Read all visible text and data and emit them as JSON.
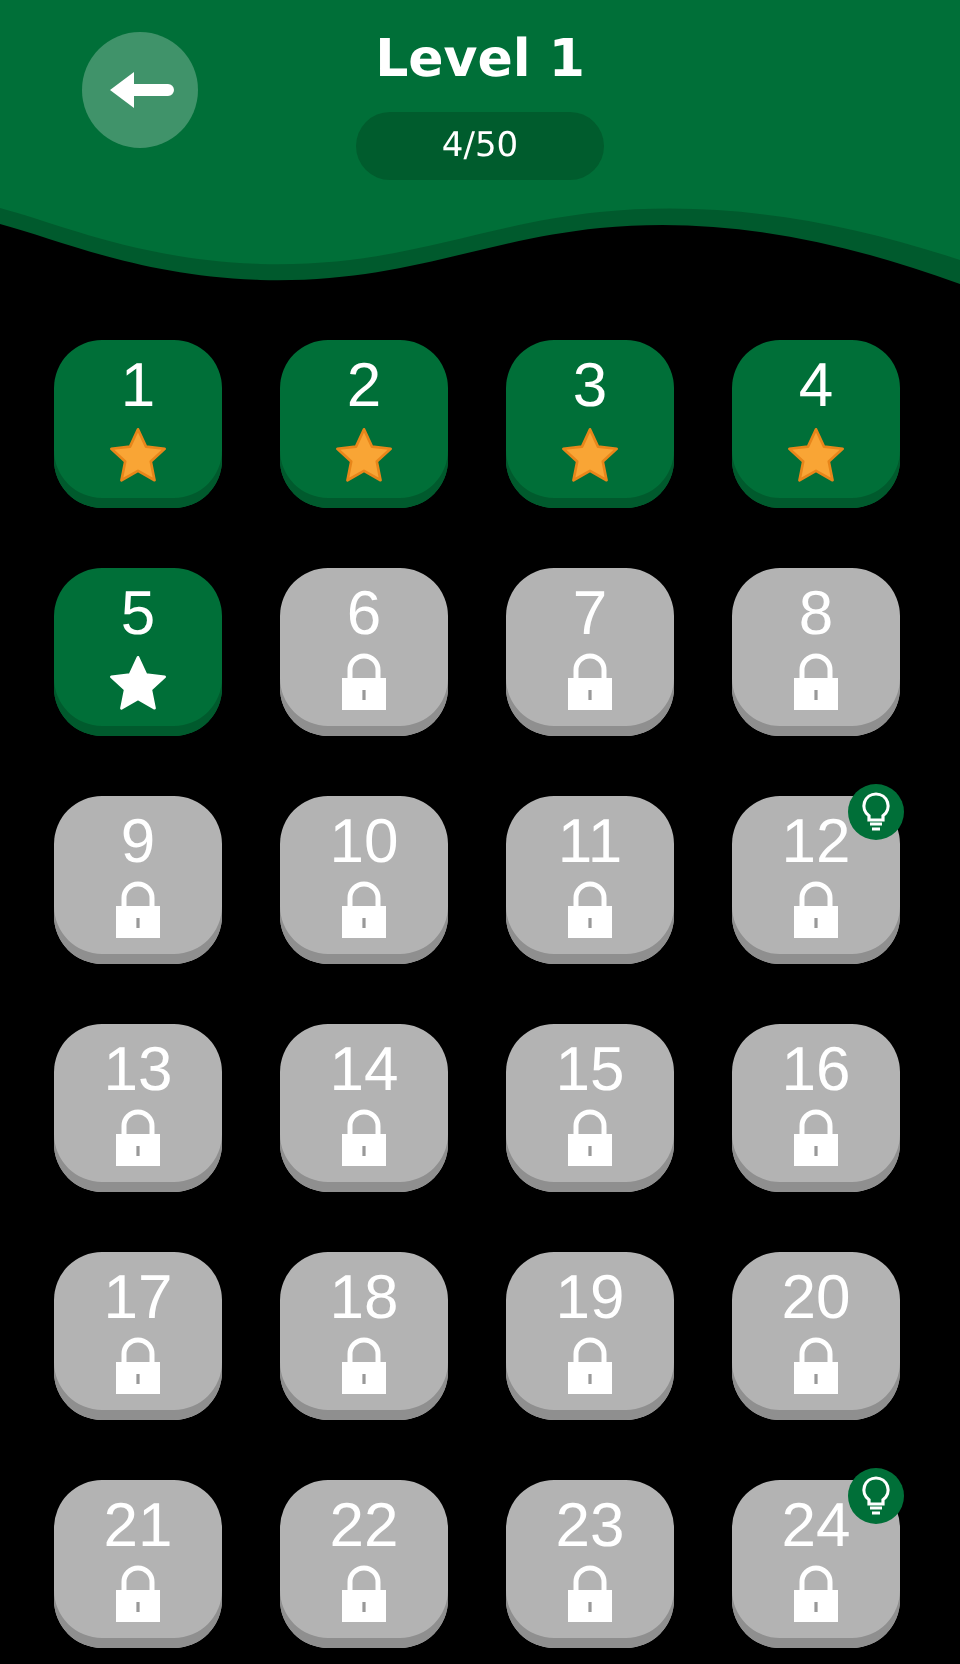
{
  "header": {
    "title": "Level 1",
    "progress": "4/50"
  },
  "levels": [
    {
      "number": "1",
      "locked": false,
      "star_earned": true,
      "hint": false
    },
    {
      "number": "2",
      "locked": false,
      "star_earned": true,
      "hint": false
    },
    {
      "number": "3",
      "locked": false,
      "star_earned": true,
      "hint": false
    },
    {
      "number": "4",
      "locked": false,
      "star_earned": true,
      "hint": false
    },
    {
      "number": "5",
      "locked": false,
      "star_earned": false,
      "hint": false
    },
    {
      "number": "6",
      "locked": true,
      "hint": false
    },
    {
      "number": "7",
      "locked": true,
      "hint": false
    },
    {
      "number": "8",
      "locked": true,
      "hint": false
    },
    {
      "number": "9",
      "locked": true,
      "hint": false
    },
    {
      "number": "10",
      "locked": true,
      "hint": false
    },
    {
      "number": "11",
      "locked": true,
      "hint": false
    },
    {
      "number": "12",
      "locked": true,
      "hint": true
    },
    {
      "number": "13",
      "locked": true,
      "hint": false
    },
    {
      "number": "14",
      "locked": true,
      "hint": false
    },
    {
      "number": "15",
      "locked": true,
      "hint": false
    },
    {
      "number": "16",
      "locked": true,
      "hint": false
    },
    {
      "number": "17",
      "locked": true,
      "hint": false
    },
    {
      "number": "18",
      "locked": true,
      "hint": false
    },
    {
      "number": "19",
      "locked": true,
      "hint": false
    },
    {
      "number": "20",
      "locked": true,
      "hint": false
    },
    {
      "number": "21",
      "locked": true,
      "hint": false
    },
    {
      "number": "22",
      "locked": true,
      "hint": false
    },
    {
      "number": "23",
      "locked": true,
      "hint": false
    },
    {
      "number": "24",
      "locked": true,
      "hint": true
    }
  ]
}
